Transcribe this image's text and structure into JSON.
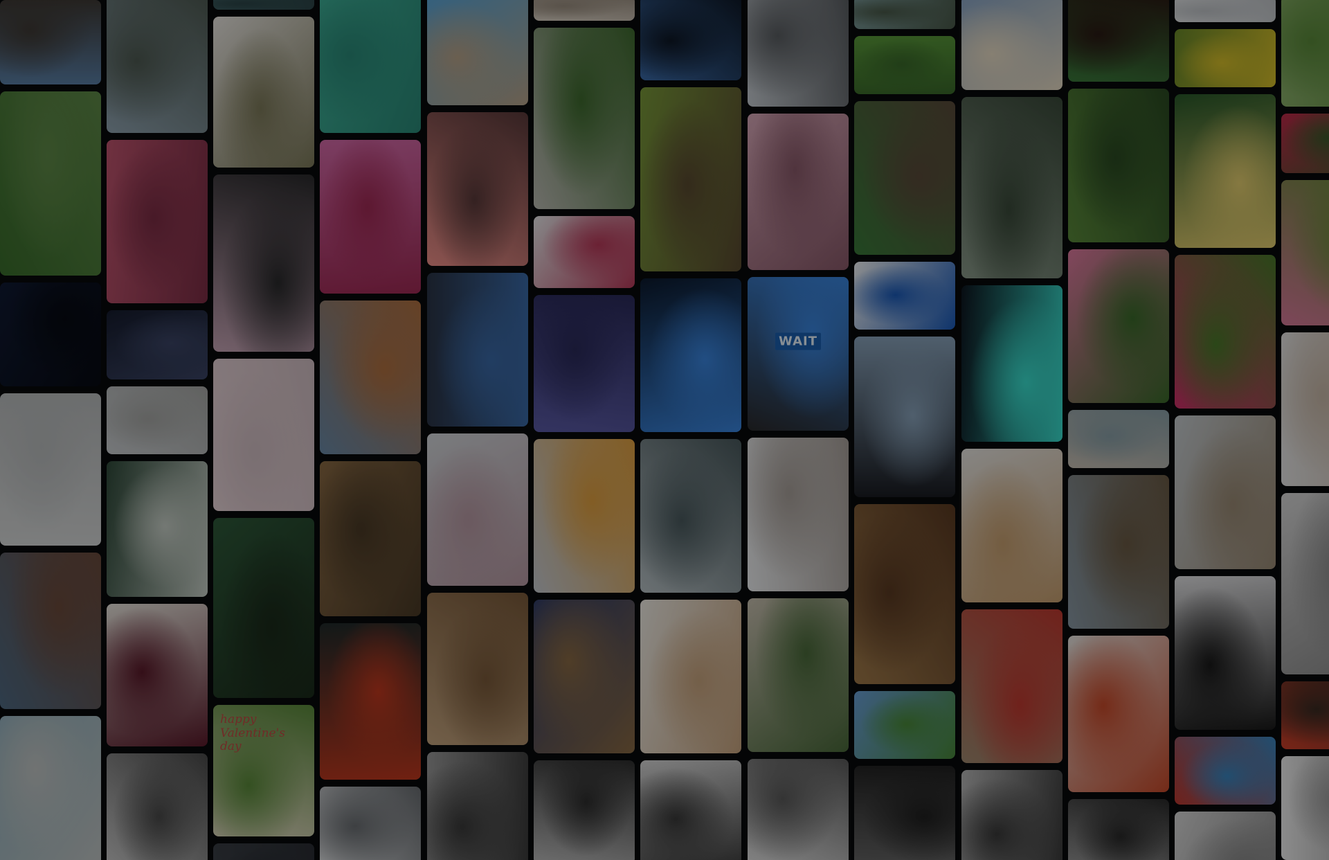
{
  "collage": {
    "columns": [
      {
        "tiles": [
          {
            "name": "photo-japanese-castle",
            "c1": "#5a7fa6",
            "c2": "#3f3a35"
          },
          {
            "name": "photo-tennis-court-aerial",
            "c1": "#3a6e2c",
            "c2": "#5f8a48"
          },
          {
            "name": "photo-starry-night-sky",
            "c1": "#101a33",
            "c2": "#070a12"
          },
          {
            "name": "photo-white-room",
            "c1": "#d6d8d8",
            "c2": "#b9bcbd"
          },
          {
            "name": "photo-temple-crowd",
            "c1": "#4f6a83",
            "c2": "#6b4a3b"
          },
          {
            "name": "photo-tomatoes-bowl",
            "c1": "#8eb0c0",
            "c2": "#c2c6c4"
          }
        ]
      },
      {
        "tiles": [
          {
            "name": "photo-snowy-hillside",
            "c1": "#8fa3b0",
            "c2": "#4e5a52"
          },
          {
            "name": "photo-pink-satin-love",
            "c1": "#c0556f",
            "c2": "#7c2d45"
          },
          {
            "name": "photo-convenience-store-night",
            "c1": "#161c2e",
            "c2": "#3b4566"
          },
          {
            "name": "photo-foggy-field",
            "c1": "#c9cdd0",
            "c2": "#a7a8a6"
          },
          {
            "name": "photo-stadium-from-below",
            "c1": "#2f4a3a",
            "c2": "#c8d0c8"
          },
          {
            "name": "photo-pink-drink-glass",
            "c1": "#e8e4dc",
            "c2": "#5a1a2a"
          },
          {
            "name": "photo-metal-sculpture",
            "c1": "#d4d4d4",
            "c2": "#4a4a4a"
          }
        ]
      },
      {
        "tiles": [
          {
            "name": "photo-lake-top",
            "c1": "#3d5f63",
            "c2": "#2c4548"
          },
          {
            "name": "photo-dog-on-rock",
            "c1": "#eae7e2",
            "c2": "#7d7a5a"
          },
          {
            "name": "photo-car-window-mirror",
            "c1": "#c7a5b6",
            "c2": "#2a2a2c"
          },
          {
            "name": "photo-cherry-blossom-branches",
            "c1": "#e8d4d8",
            "c2": "#d2bfc4"
          },
          {
            "name": "photo-phone-camera-forest",
            "c1": "#2e5a3a",
            "c2": "#1a2a1a"
          },
          {
            "name": "photo-valentines-card",
            "c1": "#e6dcc6",
            "c2": "#5a8a3a",
            "script": "happy\nValentine's\nday"
          },
          {
            "name": "photo-bottom-partial",
            "c1": "#3a3f46",
            "c2": "#2a2d33"
          }
        ]
      },
      {
        "tiles": [
          {
            "name": "photo-fish-school-water",
            "c1": "#3fb39a",
            "c2": "#2a8a78"
          },
          {
            "name": "photo-orchid-flower",
            "c1": "#d46aa8",
            "c2": "#a02a55"
          },
          {
            "name": "photo-city-street-mural",
            "c1": "#6a8aa8",
            "c2": "#b07040"
          },
          {
            "name": "photo-aerial-town",
            "c1": "#8a6a44",
            "c2": "#4a3a26"
          },
          {
            "name": "photo-koi-fish",
            "c1": "#202a2a",
            "c2": "#c2391e"
          },
          {
            "name": "photo-white-building",
            "c1": "#e4e6e8",
            "c2": "#6a6e72"
          }
        ]
      },
      {
        "tiles": [
          {
            "name": "photo-beach-waves",
            "c1": "#5aa6d8",
            "c2": "#b8a48a"
          },
          {
            "name": "photo-woman-pink-wall",
            "c1": "#f0908a",
            "c2": "#5a3a3a"
          },
          {
            "name": "photo-woman-headscarf-office",
            "c1": "#2a3446",
            "c2": "#3a6aa8"
          },
          {
            "name": "photo-woman-pink-dress",
            "c1": "#d2d6da",
            "c2": "#b89aa4"
          },
          {
            "name": "photo-european-courtyard",
            "c1": "#c4a47e",
            "c2": "#7a5a3a"
          },
          {
            "name": "photo-pagoda-street-bw",
            "c1": "#9a9a9a",
            "c2": "#3a3a3a"
          }
        ]
      },
      {
        "tiles": [
          {
            "name": "photo-white-marble-building",
            "c1": "#d8cfc2",
            "c2": "#9a8e80"
          },
          {
            "name": "photo-mossy-rocks",
            "c1": "#bcbcb4",
            "c2": "#3e6a2e"
          },
          {
            "name": "photo-paint-palette",
            "c1": "#e8e8ea",
            "c2": "#b83a5a"
          },
          {
            "name": "photo-purple-sky-branches",
            "c1": "#5a5aa6",
            "c2": "#2a2a5a"
          },
          {
            "name": "photo-blossom-butterfly",
            "c1": "#c8ccd2",
            "c2": "#e0a040"
          },
          {
            "name": "photo-ancient-ruins",
            "c1": "#2a3a6a",
            "c2": "#8a6a44"
          },
          {
            "name": "photo-wooden-slats-bw",
            "c1": "#bdbdbd",
            "c2": "#2e2e2e"
          }
        ]
      },
      {
        "tiles": [
          {
            "name": "photo-city-skyline-silhouette",
            "c1": "#3a6aa8",
            "c2": "#0e1826"
          },
          {
            "name": "photo-cat-in-grass",
            "c1": "#7a9a3a",
            "c2": "#5a4a30"
          },
          {
            "name": "photo-woman-blue-fabric",
            "c1": "#0c1a2e",
            "c2": "#3a86e0"
          },
          {
            "name": "photo-lighthouse-island",
            "c1": "#b8c2c6",
            "c2": "#4a5a5e"
          },
          {
            "name": "photo-coffee-and-donut",
            "c1": "#f0ede6",
            "c2": "#c8a47e"
          },
          {
            "name": "photo-bare-tree-bw",
            "c1": "#d8d8d8",
            "c2": "#3a3a3a"
          }
        ]
      },
      {
        "tiles": [
          {
            "name": "photo-snowy-mountains",
            "c1": "#c6ccd2",
            "c2": "#5a5e62"
          },
          {
            "name": "photo-pink-blossoms",
            "c1": "#d8a8b8",
            "c2": "#8a5a6a"
          },
          {
            "name": "photo-wait-crosswalk-button",
            "c1": "#2a2a2c",
            "c2": "#3a86e0",
            "word": "WAIT"
          },
          {
            "name": "photo-white-fabric-tent",
            "c1": "#eef0f2",
            "c2": "#a8a09a"
          },
          {
            "name": "photo-woman-walking-wall",
            "c1": "#c8c0b0",
            "c2": "#4a6a3a"
          },
          {
            "name": "photo-snow-person-bw",
            "c1": "#e6e6e6",
            "c2": "#5a5a5a"
          }
        ]
      },
      {
        "tiles": [
          {
            "name": "photo-city-top",
            "c1": "#7a9a9a",
            "c2": "#4a5a4a"
          },
          {
            "name": "photo-green-field-path",
            "c1": "#5a9a3a",
            "c2": "#3a6a2a"
          },
          {
            "name": "photo-woman-bench-park",
            "c1": "#3a7a3a",
            "c2": "#5a4a3a"
          },
          {
            "name": "photo-blue-door-white-wall",
            "c1": "#f2f4f6",
            "c2": "#1a5ab8"
          },
          {
            "name": "photo-airplane-window",
            "c1": "#1a1c22",
            "c2": "#8aa4bc"
          },
          {
            "name": "photo-brown-branches",
            "c1": "#a07a4a",
            "c2": "#5a3a22"
          },
          {
            "name": "photo-kids-in-field",
            "c1": "#6aa0d8",
            "c2": "#4a8a3a"
          },
          {
            "name": "photo-woman-headwrap-bw",
            "c1": "#6a6a6a",
            "c2": "#202020"
          }
        ]
      },
      {
        "tiles": [
          {
            "name": "photo-beach-signpost",
            "c1": "#8aa6c6",
            "c2": "#e8dcc4"
          },
          {
            "name": "photo-misty-tree",
            "c1": "#8a9a8a",
            "c2": "#3a4a3a"
          },
          {
            "name": "photo-neon-street-night",
            "c1": "#0e1620",
            "c2": "#3ae0d0"
          },
          {
            "name": "photo-book-tulips-tea",
            "c1": "#e8e6e2",
            "c2": "#c8a070"
          },
          {
            "name": "photo-venice-canal",
            "c1": "#a08a70",
            "c2": "#c03a30"
          },
          {
            "name": "photo-mountain-mist-bw",
            "c1": "#b8b8b8",
            "c2": "#3a3a3a"
          }
        ]
      },
      {
        "tiles": [
          {
            "name": "photo-portrait-leaves",
            "c1": "#3a7a3a",
            "c2": "#2a1a14"
          },
          {
            "name": "photo-pine-tree",
            "c1": "#5a8a3a",
            "c2": "#2a4a22"
          },
          {
            "name": "photo-pink-tulips",
            "c1": "#e07aa0",
            "c2": "#3a6a2a"
          },
          {
            "name": "photo-trevi-fountain",
            "c1": "#c8c0b4",
            "c2": "#8aa0a8"
          },
          {
            "name": "photo-island-castle-shore",
            "c1": "#8a9aa6",
            "c2": "#6a5a44"
          },
          {
            "name": "photo-soup-bowl",
            "c1": "#e8e6e2",
            "c2": "#c84a2a"
          },
          {
            "name": "photo-crosswalk-bw",
            "c1": "#a8a8a8",
            "c2": "#2a2a2a"
          }
        ]
      },
      {
        "tiles": [
          {
            "name": "photo-white-building-top",
            "c1": "#e6e8ea",
            "c2": "#c0c4c8"
          },
          {
            "name": "photo-yellow-flowers",
            "c1": "#6a8a2a",
            "c2": "#d8c02a"
          },
          {
            "name": "photo-woman-yellow-dress",
            "c1": "#2a5a2a",
            "c2": "#e6d070"
          },
          {
            "name": "photo-dragon-fruit",
            "c1": "#d0306a",
            "c2": "#4a7a2a"
          },
          {
            "name": "photo-couple-boardwalk",
            "c1": "#c6ccd0",
            "c2": "#9a8a74"
          },
          {
            "name": "photo-woman-black-dress",
            "c1": "#e2e2e4",
            "c2": "#1a1a1a"
          },
          {
            "name": "photo-red-storefront",
            "c1": "#c03a30",
            "c2": "#3a86c0"
          },
          {
            "name": "photo-white-flower-bw",
            "c1": "#d8d8d8",
            "c2": "#8a8a8a"
          }
        ]
      },
      {
        "tiles": [
          {
            "name": "photo-hand-grass",
            "c1": "#8ab06a",
            "c2": "#5a8a3a"
          },
          {
            "name": "photo-red-flowers",
            "c1": "#c02a4a",
            "c2": "#3a5a2a"
          },
          {
            "name": "photo-pink-trees-field",
            "c1": "#d87a9a",
            "c2": "#6a8a3a"
          },
          {
            "name": "photo-bed-sheets",
            "c1": "#e6e6e6",
            "c2": "#c8b8a8"
          },
          {
            "name": "photo-window-light",
            "c1": "#d8d8d8",
            "c2": "#8a8a8a"
          },
          {
            "name": "photo-torii-gates",
            "c1": "#d0402a",
            "c2": "#3a2a22"
          },
          {
            "name": "photo-white-flowers-bottom",
            "c1": "#f0f0f0",
            "c2": "#9a9a9a"
          }
        ]
      }
    ]
  }
}
